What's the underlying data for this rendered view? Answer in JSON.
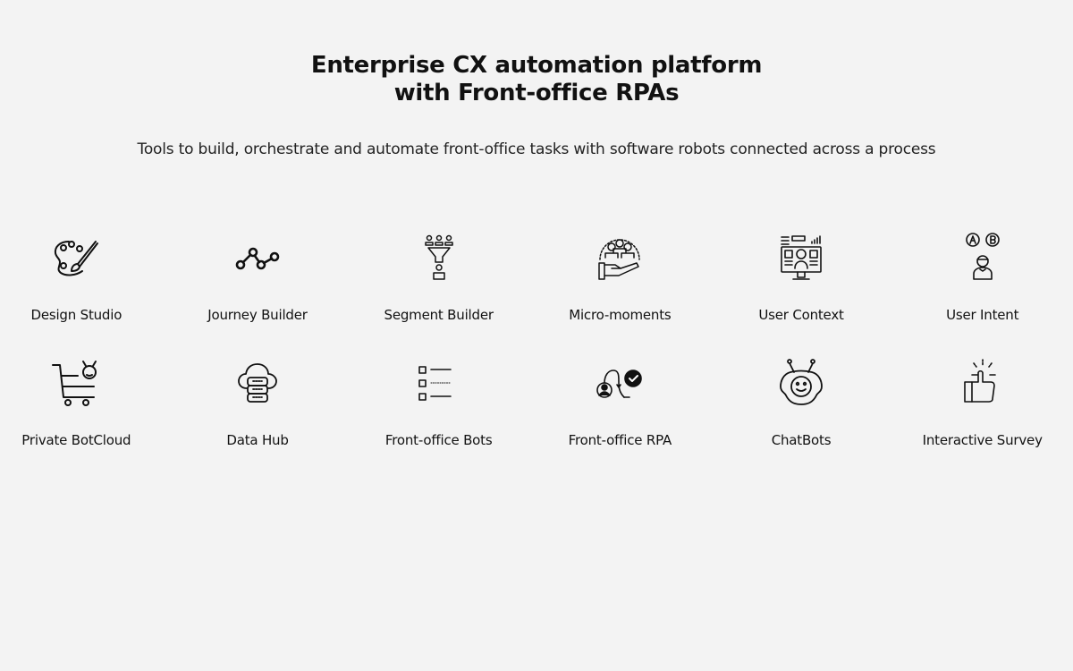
{
  "header": {
    "title_line1": "Enterprise CX automation platform",
    "title_line2": "with Front-office RPAs",
    "subtitle": "Tools to build, orchestrate and automate front-office tasks with software robots connected across a process"
  },
  "features": [
    {
      "label": "Design Studio",
      "icon": "palette-icon"
    },
    {
      "label": "Journey Builder",
      "icon": "journey-nodes-icon"
    },
    {
      "label": "Segment Builder",
      "icon": "funnel-users-icon"
    },
    {
      "label": "Micro-moments",
      "icon": "hand-group-icon"
    },
    {
      "label": "User Context",
      "icon": "monitor-user-icon"
    },
    {
      "label": "User Intent",
      "icon": "user-choice-icon"
    },
    {
      "label": "Private BotCloud",
      "icon": "cart-bot-icon"
    },
    {
      "label": "Data Hub",
      "icon": "cloud-database-icon"
    },
    {
      "label": "Front-office Bots",
      "icon": "checklist-icon"
    },
    {
      "label": "Front-office RPA",
      "icon": "workflow-check-icon"
    },
    {
      "label": "ChatBots",
      "icon": "robot-face-icon"
    },
    {
      "label": "Interactive Survey",
      "icon": "thumbs-up-icon"
    }
  ]
}
